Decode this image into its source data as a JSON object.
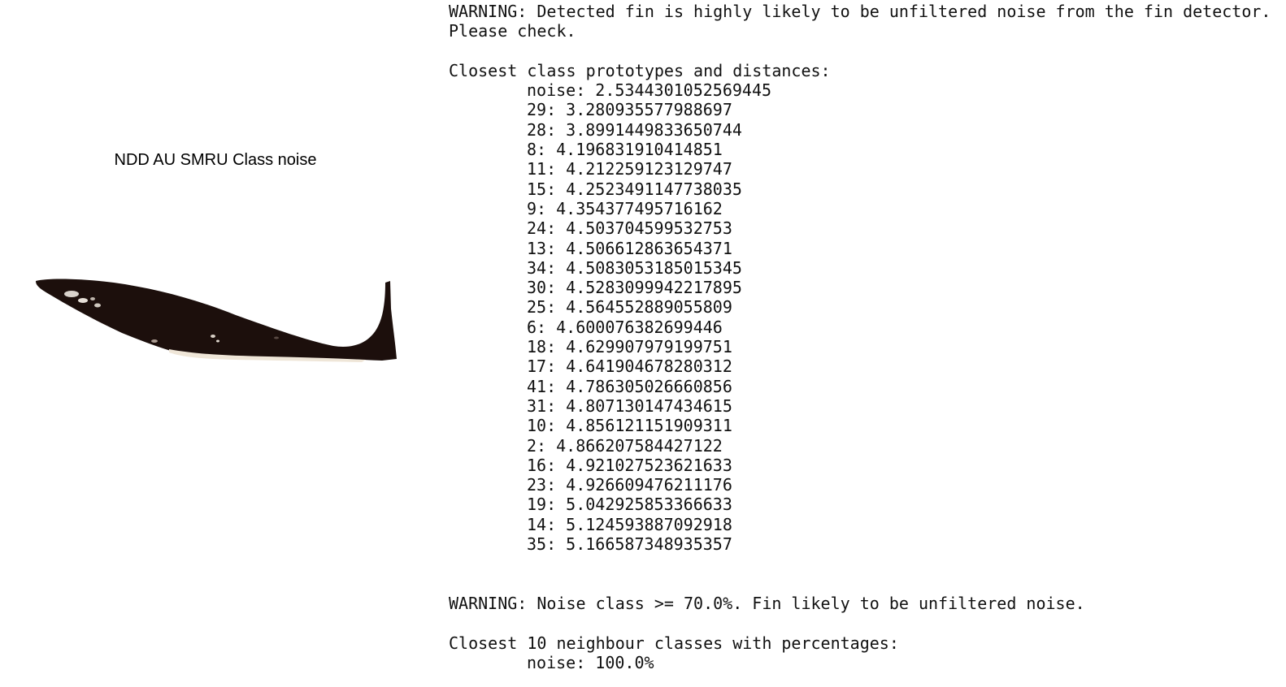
{
  "left_panel": {
    "title": "NDD AU SMRU Class noise",
    "fin_image": "dark-fin-silhouette"
  },
  "console": {
    "warning_noise_detector": [
      "WARNING: Detected fin is highly likely to be unfiltered noise from the fin detector.",
      "Please check."
    ],
    "prototypes_header": "Closest class prototypes and distances:",
    "prototypes": [
      "noise: 2.5344301052569445",
      "29: 3.280935577988697",
      "28: 3.8991449833650744",
      "8: 4.196831910414851",
      "11: 4.212259123129747",
      "15: 4.2523491147738035",
      "9: 4.354377495716162",
      "24: 4.503704599532753",
      "13: 4.506612863654371",
      "34: 4.5083053185015345",
      "30: 4.5283099942217895",
      "25: 4.564552889055809",
      "6: 4.600076382699446",
      "18: 4.629907979199751",
      "17: 4.641904678280312",
      "41: 4.786305026660856",
      "31: 4.807130147434615",
      "10: 4.856121151909311",
      "2: 4.866207584427122",
      "16: 4.921027523621633",
      "23: 4.926609476211176",
      "19: 5.042925853366633",
      "14: 5.124593887092918",
      "35: 5.166587348935357"
    ],
    "warning_noise_class": "WARNING: Noise class >= 70.0%. Fin likely to be unfiltered noise.",
    "neighbours_header": "Closest 10 neighbour classes with percentages:",
    "neighbours": [
      "noise: 100.0%"
    ]
  }
}
